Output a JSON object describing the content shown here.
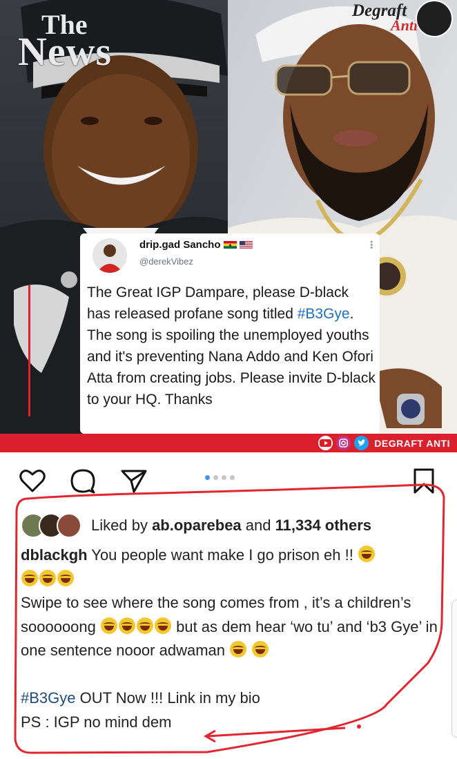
{
  "media": {
    "news_logo_the": "The",
    "news_logo_news": "News",
    "degraft_logo_line1": "Degraft",
    "degraft_logo_line2": "Anti",
    "tweet": {
      "display_name": "drip.gad Sancho",
      "handle": "@derekVibez",
      "text_part1": "The Great IGP Dampare, please D-black has released profane song titled ",
      "hashtag": "#B3Gye",
      "text_part2": ". The song is spoiling the unemployed youths and it's preventing Nana Addo and Ken Ofori Atta from creating jobs. Please invite D-black to your HQ. Thanks"
    },
    "banner_label": "DEGRAFT ANTI",
    "banner_icons": [
      "youtube-icon",
      "instagram-icon",
      "twitter-icon"
    ]
  },
  "post": {
    "carousel": {
      "count": 4,
      "active_index": 0
    },
    "likes_prefix": "Liked by ",
    "liked_by_user": "ab.oparebea",
    "likes_middle": " and ",
    "likes_count": "11,334 others",
    "caption_user": "dblackgh",
    "caption_line1": " You people want make I go prison eh !! ",
    "caption_para2_a": "Swipe to see where the song comes from , it’s a children’s soooooong ",
    "caption_para2_b": " but as dem hear ‘wo tu’ and ‘b3 Gye’ in one sentence nooor adwaman ",
    "caption_hashtag": "#B3Gye",
    "caption_para3": " OUT Now !!! Link in my bio",
    "caption_para4": "PS : IGP no mind dem"
  },
  "colors": {
    "accent_red": "#d9202c",
    "hashtag_blue": "#1d6fbf",
    "carousel_active": "#3f97f0"
  }
}
